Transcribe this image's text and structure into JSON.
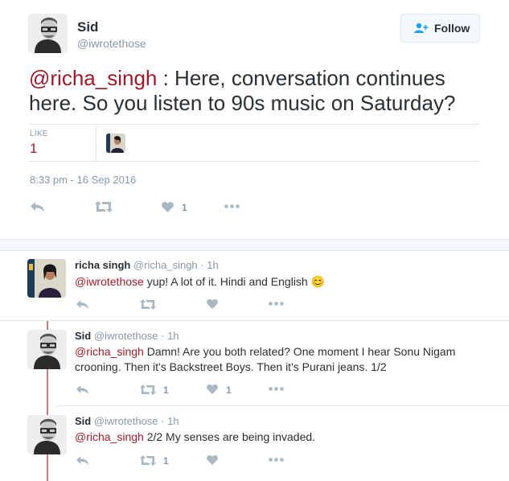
{
  "main_tweet": {
    "author_name": "Sid",
    "author_handle": "@iwrotethose",
    "follow_label": "Follow",
    "mention": "@richa_singh",
    "text": " : Here, conversation continues here. So you listen to 90s music on Saturday?",
    "likes_label": "LIKE",
    "likes_count": "1",
    "timestamp": "8:33 pm - 16 Sep 2016",
    "action_like_count": "1"
  },
  "replies": [
    {
      "author_name": "richa singh",
      "author_handle": "@richa_singh",
      "time": "· 1h",
      "mention": "@iwrotethose",
      "text": " yup! A lot of it. Hindi and English ",
      "emoji": "😊",
      "retweet_count": "",
      "like_count": ""
    },
    {
      "author_name": "Sid",
      "author_handle": "@iwrotethose",
      "time": "· 1h",
      "mention": "@richa_singh",
      "text": " Damn! Are you both related? One moment I hear Sonu Nigam crooning. Then it's Backstreet Boys. Then it's Purani jeans. 1/2",
      "retweet_count": "1",
      "like_count": "1"
    },
    {
      "author_name": "Sid",
      "author_handle": "@iwrotethose",
      "time": "· 1h",
      "mention": "@richa_singh",
      "text": " 2/2 My senses are being invaded.",
      "retweet_count": "1",
      "like_count": ""
    }
  ],
  "colors": {
    "mention": "#9d1b28",
    "muted": "#8899a6",
    "thread_line": "#c57b82"
  }
}
